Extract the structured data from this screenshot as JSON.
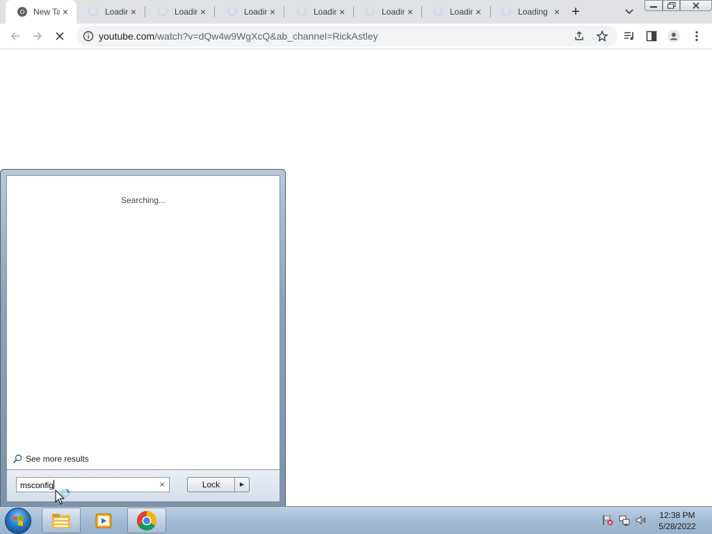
{
  "browser": {
    "tabs": [
      {
        "label": "New Tab",
        "state": "loaded",
        "icon": "chrome-icon"
      },
      {
        "label": "Loading",
        "state": "loading",
        "icon": "spinner-icon"
      },
      {
        "label": "Loading",
        "state": "loading",
        "icon": "spinner-icon"
      },
      {
        "label": "Loading",
        "state": "loading",
        "icon": "spinner-icon"
      },
      {
        "label": "Loading",
        "state": "loading",
        "icon": "spinner-icon"
      },
      {
        "label": "Loading",
        "state": "loading",
        "icon": "spinner-icon"
      },
      {
        "label": "Loading",
        "state": "loading",
        "icon": "spinner-icon"
      },
      {
        "label": "Loading",
        "state": "loading",
        "icon": "spinner-icon"
      }
    ],
    "tab_close_glyph": "×",
    "new_tab_glyph": "+",
    "url": {
      "host": "youtube.com",
      "path": "/watch?v=dQw4w9WgXcQ&ab_channel=RickAstley"
    }
  },
  "start_menu": {
    "status_text": "Searching...",
    "see_more_label": "See more results",
    "search_value": "msconfig",
    "clear_glyph": "×",
    "lock_label": "Lock",
    "lock_arrow_glyph": "▶"
  },
  "taskbar": {
    "apps": [
      "windows-explorer-icon",
      "media-player-icon",
      "chrome-icon"
    ],
    "tray_icons": [
      "action-center-flag-icon",
      "network-icon",
      "volume-icon"
    ],
    "time": "12:38 PM",
    "date": "5/28/2022"
  },
  "colors": {
    "tabstrip": "#dfe1e5",
    "taskbar": "#a3bcd5",
    "start_menu_frame": "#8ea3b8"
  }
}
